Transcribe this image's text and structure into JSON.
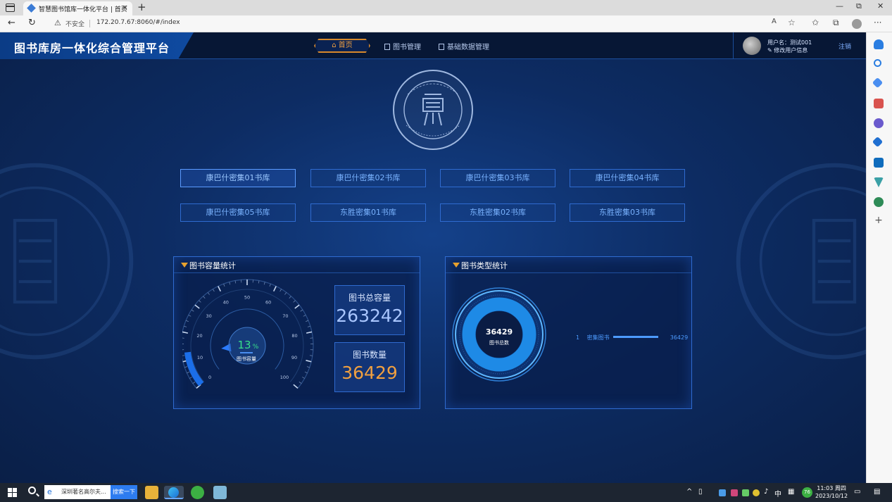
{
  "browser": {
    "tab_title": "智慧图书馆库一体化平台 | 首页",
    "url": "172.20.7.67:8060/#/index",
    "security_label": "不安全",
    "close_glyph": "×",
    "new_tab_glyph": "+",
    "minimize_glyph": "—",
    "maximize_glyph": "⧉",
    "window_close_glyph": "✕",
    "back_glyph": "←",
    "refresh_glyph": "↻",
    "read_aloud_glyph": "A",
    "favorite_glyph": "☆",
    "more_glyph": "···"
  },
  "header": {
    "title": "图书库房一体化综合管理平台",
    "nav": [
      {
        "label": "首页",
        "icon": "home-icon"
      },
      {
        "label": "图书管理",
        "icon": "book-icon"
      },
      {
        "label": "基础数据管理",
        "icon": "database-icon"
      }
    ],
    "user_name": "用户名：测试001",
    "edit_user": "修改用户信息",
    "logout": "注销"
  },
  "warehouses": [
    "康巴什密集01书库",
    "康巴什密集02书库",
    "康巴什密集03书库",
    "康巴什密集04书库",
    "康巴什密集05书库",
    "东胜密集01书库",
    "东胜密集02书库",
    "东胜密集03书库"
  ],
  "capacity_panel": {
    "title": "图书容量统计",
    "gauge_percent": 13,
    "gauge_percent_label": "13",
    "gauge_percent_unit": "%",
    "gauge_caption": "图书容量",
    "gauge_ticks": [
      "0",
      "10",
      "20",
      "30",
      "40",
      "50",
      "60",
      "70",
      "80",
      "90",
      "100"
    ],
    "total_capacity_label": "图书总容量",
    "total_capacity": "263242",
    "book_count_label": "图书数量",
    "book_count": "36429"
  },
  "type_panel": {
    "title": "图书类型统计",
    "total_value": "36429",
    "total_caption": "图书总数",
    "legend": [
      {
        "index": "1",
        "name": "密集图书",
        "value": "36429"
      }
    ]
  },
  "taskbar": {
    "search_text": "深圳著名高尔夫...",
    "search_button": "搜索一下",
    "ime_label": "中",
    "badge": "76",
    "time": "11:03 周四",
    "date": "2023/10/12"
  },
  "colors": {
    "accent_orange": "#d7882b",
    "capacity_value": "#a9c6ff",
    "count_value": "#f0a040",
    "gauge_percent_text": "#38e08a",
    "ring_blue": "#1e8ae6"
  }
}
